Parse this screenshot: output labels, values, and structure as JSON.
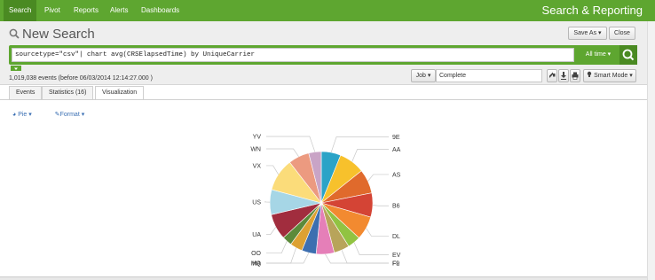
{
  "nav": {
    "items": [
      "Search",
      "Pivot",
      "Reports",
      "Alerts",
      "Dashboards"
    ],
    "app_title": "Search & Reporting"
  },
  "header": {
    "title": "New Search",
    "save_as": "Save As ▾",
    "close": "Close"
  },
  "search": {
    "query": "sourcetype=\"csv\"| chart avg(CRSElapsedTime) by UniqueCarrier",
    "time_range": "All time ▾"
  },
  "status": {
    "events": "1,019,038 events (before 06/03/2014 12:14:27.000 )",
    "job": "Job ▾",
    "job_status": "Complete",
    "mode": "Smart Mode ▾"
  },
  "tabs": [
    "Events",
    "Statistics (16)",
    "Visualization"
  ],
  "viz": {
    "pie_menu": "Pie ▾",
    "format_menu": "Format ▾"
  },
  "colors": {
    "brand": "#5ea630",
    "brand_dark": "#4a8a22",
    "link": "#3a6fb3"
  },
  "chart_data": {
    "type": "pie",
    "categories": [
      "9E",
      "AA",
      "AS",
      "B6",
      "DL",
      "EV",
      "F9",
      "FL",
      "HA",
      "MQ",
      "OO",
      "UA",
      "US",
      "VX",
      "WN",
      "YV"
    ],
    "values": [
      7.0,
      9.3,
      8.7,
      8.7,
      8.5,
      4.7,
      5.6,
      6.5,
      5.2,
      4.5,
      3.5,
      9.3,
      9.0,
      11.8,
      7.5,
      4.5
    ],
    "colors": [
      "#2ba3c7",
      "#f7c12c",
      "#e06a2c",
      "#d44435",
      "#f28a30",
      "#91c342",
      "#b8a45a",
      "#e57fb8",
      "#3d6fb0",
      "#dda132",
      "#5b8a3a",
      "#a12d3e",
      "#a6d6e6",
      "#fbdc7a",
      "#ec9a80",
      "#c9a4c6"
    ],
    "title": "",
    "legend": "none"
  }
}
